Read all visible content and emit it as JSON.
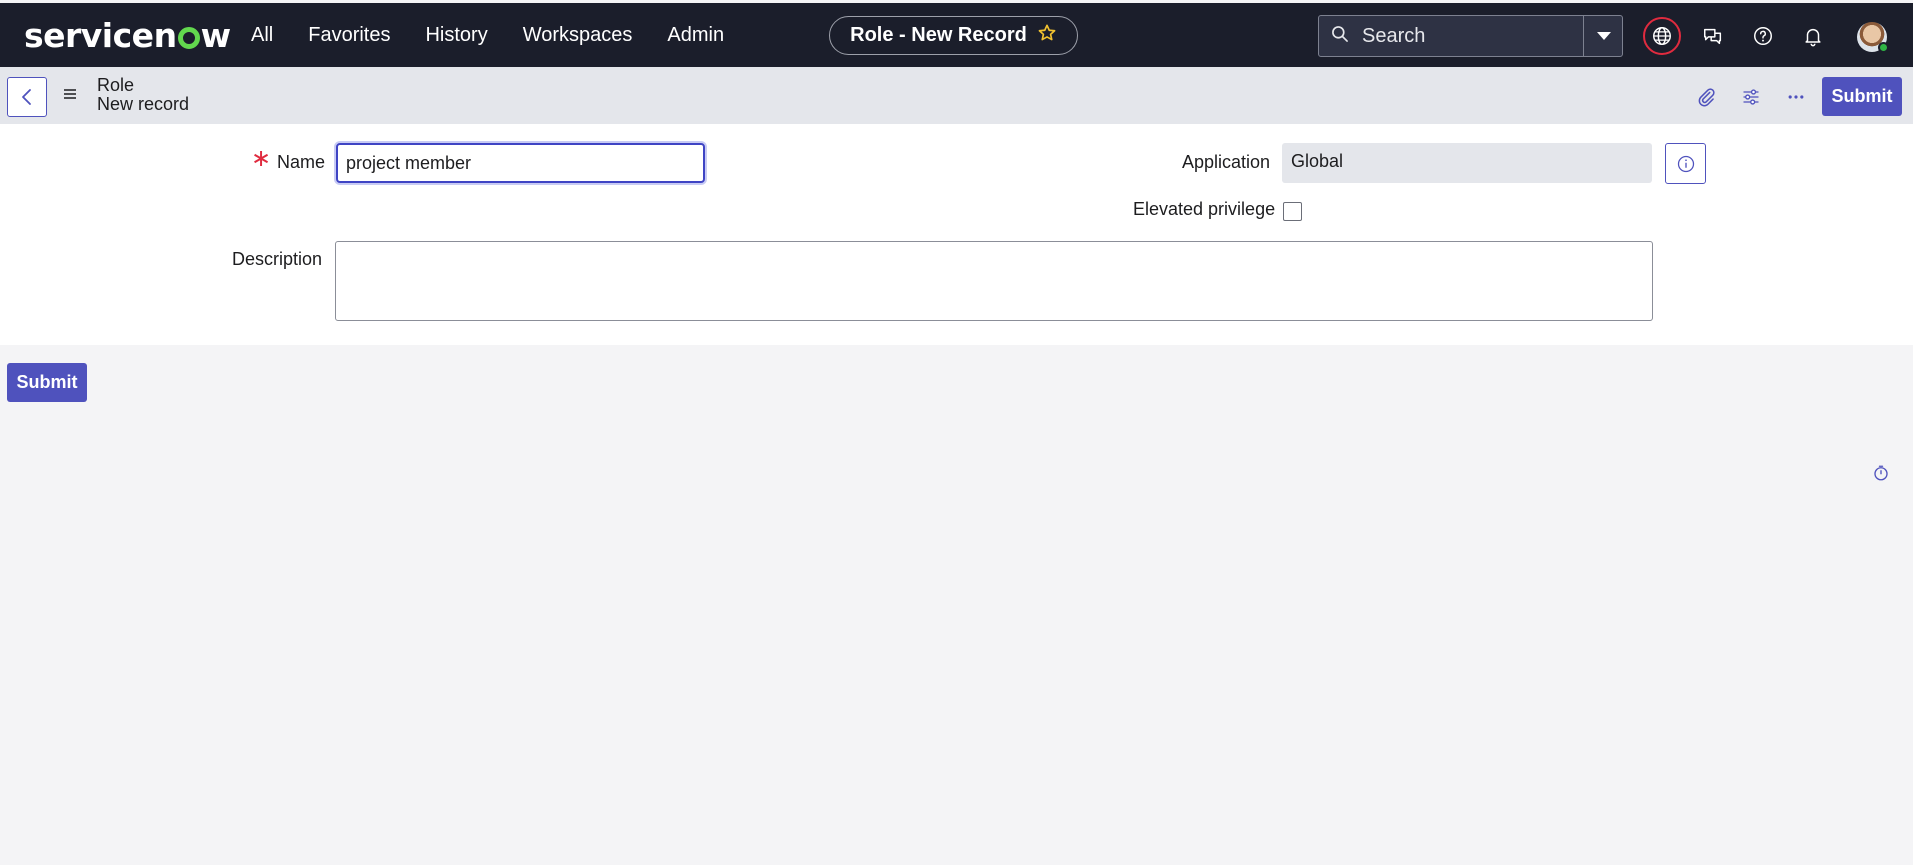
{
  "brand": {
    "logo_text_a": "servicen",
    "logo_text_b": "w"
  },
  "nav": {
    "links": [
      "All",
      "Favorites",
      "History",
      "Workspaces",
      "Admin"
    ],
    "context_title": "Role - New Record",
    "search_placeholder": "Search"
  },
  "subheader": {
    "breadcrumb_table": "Role",
    "breadcrumb_record": "New record",
    "submit_label": "Submit"
  },
  "form": {
    "name_label": "Name",
    "name_value": "project member",
    "application_label": "Application",
    "application_value": "Global",
    "elevated_label": "Elevated privilege",
    "elevated_checked": false,
    "description_label": "Description",
    "description_value": ""
  },
  "footer": {
    "submit_label": "Submit"
  },
  "colors": {
    "nav_bg": "#1b1e2b",
    "accent": "#4f52bd",
    "required": "#e02b3f",
    "presence": "#2fb344"
  }
}
